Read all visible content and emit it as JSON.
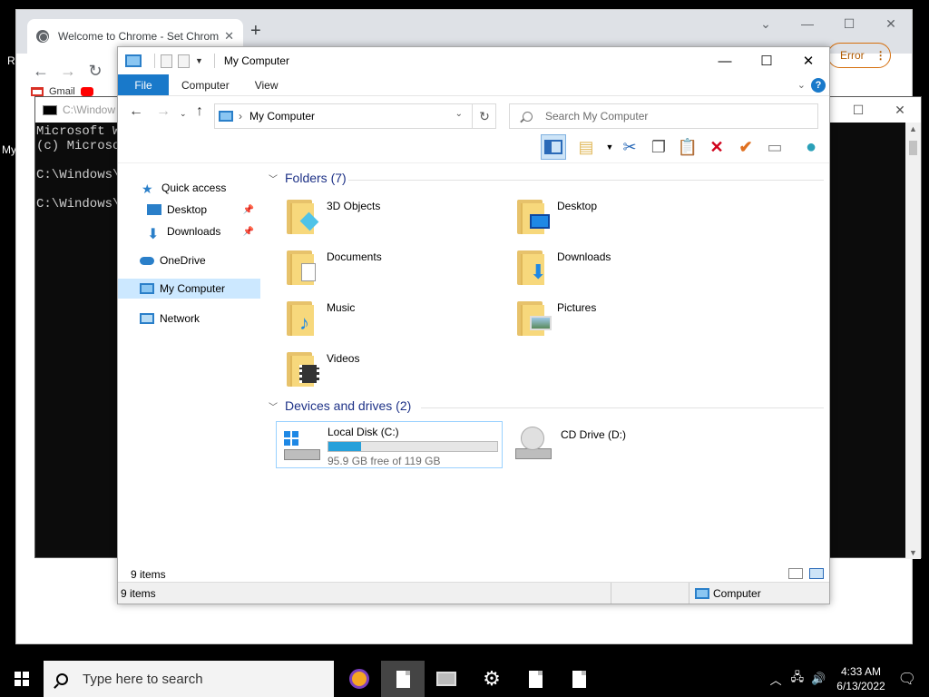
{
  "desktop": {
    "fragment_a": "R",
    "fragment_b": "My"
  },
  "chrome": {
    "tab_title": "Welcome to Chrome - Set Chrom",
    "error_label": "Error",
    "bookmarks": [
      "Gmail"
    ]
  },
  "cmd": {
    "title": "C:\\Window",
    "lines": "Microsoft W\n(c) Microso\n\nC:\\Windows\\S\n\nC:\\Windows\\S"
  },
  "explorer": {
    "title": "My Computer",
    "ribbon_tabs": {
      "file": "File",
      "computer": "Computer",
      "view": "View"
    },
    "address": "My Computer",
    "search_placeholder": "Search My Computer",
    "nav": {
      "quick_access": "Quick access",
      "desktop": "Desktop",
      "downloads": "Downloads",
      "onedrive": "OneDrive",
      "my_computer": "My Computer",
      "network": "Network"
    },
    "folders_header": "Folders (7)",
    "folders": [
      {
        "name": "3D Objects"
      },
      {
        "name": "Desktop"
      },
      {
        "name": "Documents"
      },
      {
        "name": "Downloads"
      },
      {
        "name": "Music"
      },
      {
        "name": "Pictures"
      },
      {
        "name": "Videos"
      }
    ],
    "drives_header": "Devices and drives (2)",
    "drives": [
      {
        "name": "Local Disk (C:)",
        "free_text": "95.9 GB free of 119 GB",
        "used_fraction": 0.194
      },
      {
        "name": "CD Drive (D:)"
      }
    ],
    "item_count": "9 items",
    "status_left": "9 items",
    "status_right": "Computer"
  },
  "taskbar": {
    "search_placeholder": "Type here to search",
    "time": "4:33 AM",
    "date": "6/13/2022"
  },
  "colors": {
    "accent": "#1979ca",
    "folder": "#f7d87c",
    "group_header": "#1e3287",
    "progress": "#26a0da"
  }
}
